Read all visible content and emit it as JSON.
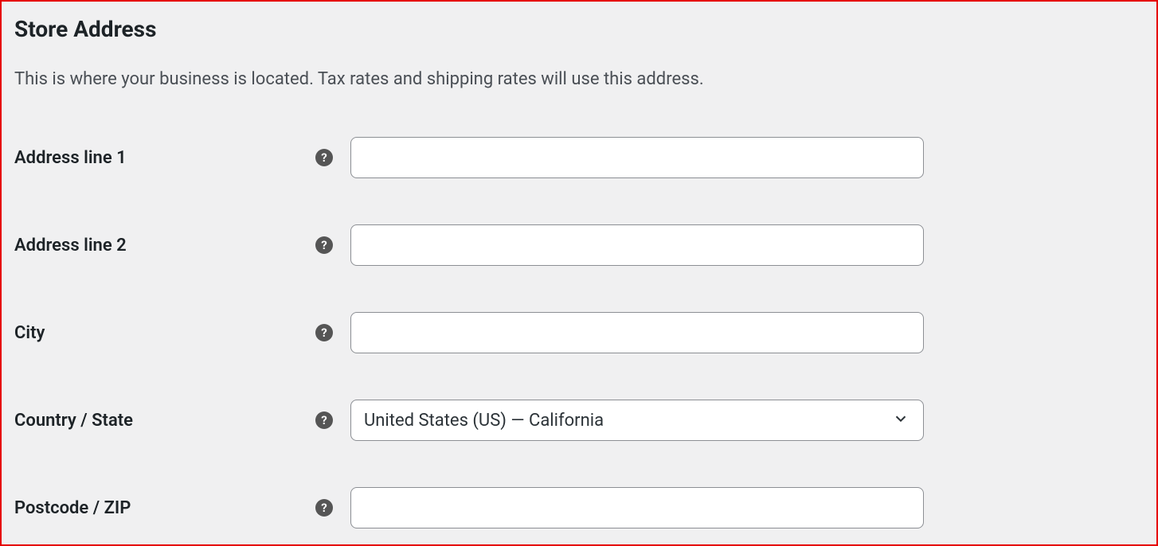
{
  "section": {
    "title": "Store Address",
    "description": "This is where your business is located. Tax rates and shipping rates will use this address."
  },
  "fields": {
    "address1": {
      "label": "Address line 1",
      "value": ""
    },
    "address2": {
      "label": "Address line 2",
      "value": ""
    },
    "city": {
      "label": "City",
      "value": ""
    },
    "country_state": {
      "label": "Country / State",
      "selected": "United States (US) — California"
    },
    "postcode": {
      "label": "Postcode / ZIP",
      "value": ""
    }
  },
  "icons": {
    "help_glyph": "?"
  }
}
